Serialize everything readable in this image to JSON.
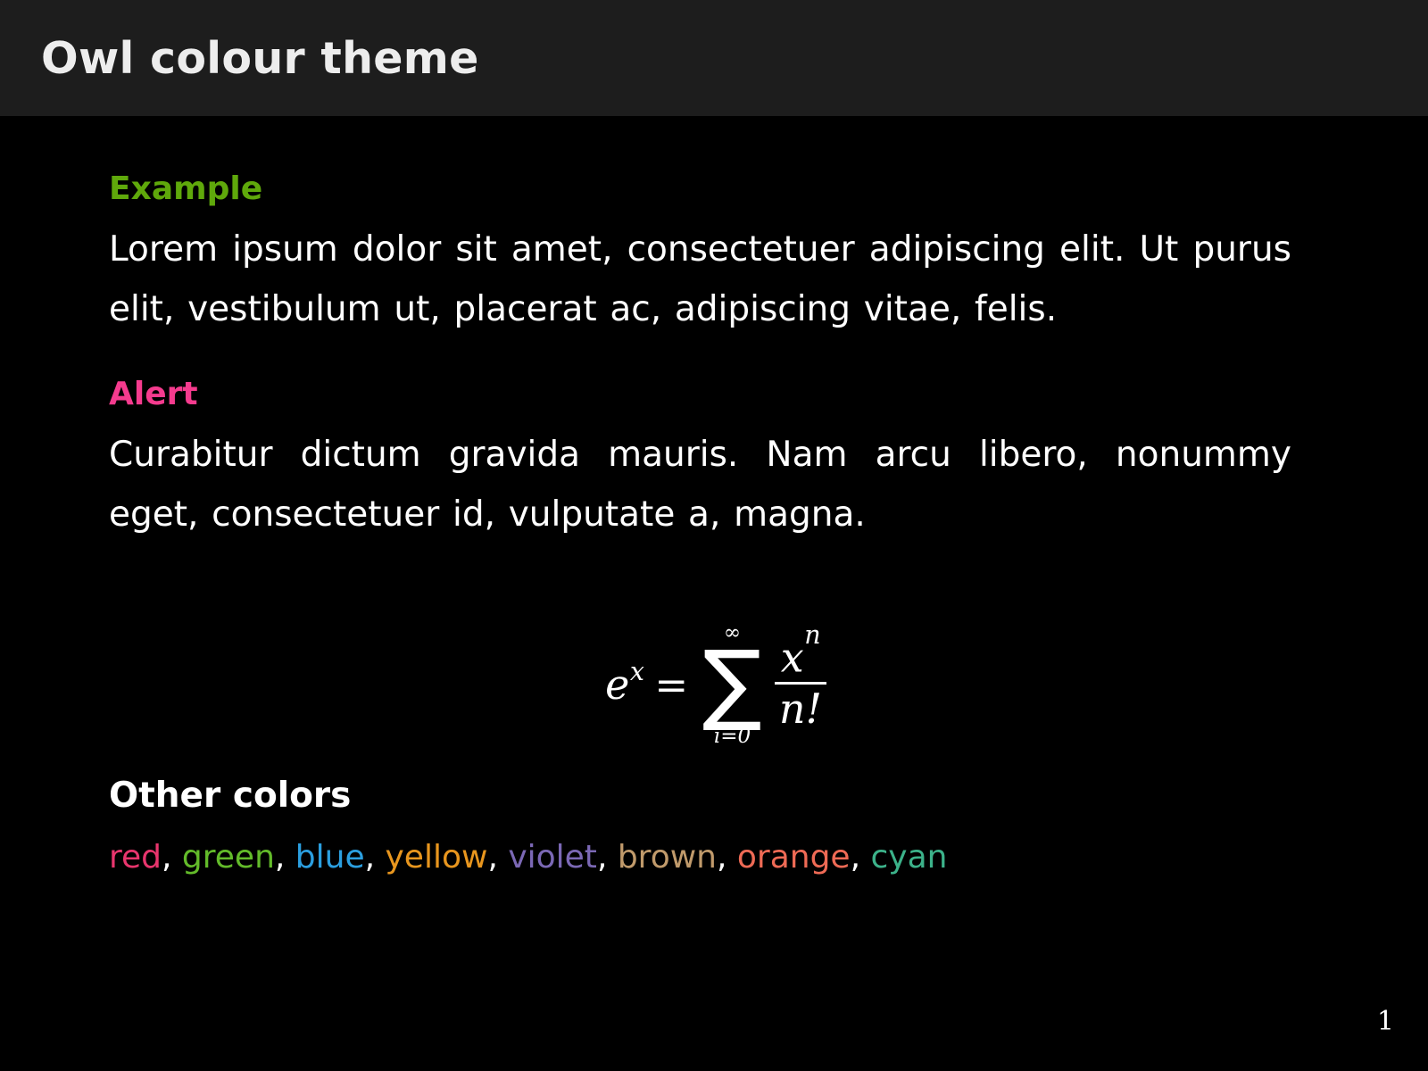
{
  "slide": {
    "title": "Owl colour theme",
    "page_number": "1",
    "background_color": "#000000",
    "titlebar_color": "#1d1d1d",
    "text_color": "#ffffff"
  },
  "blocks": [
    {
      "kind": "example",
      "heading": "Example",
      "heading_color": "#5fa80b",
      "body": "Lorem ipsum dolor sit amet, consectetuer adipiscing elit. Ut purus elit, vestibulum ut, placerat ac, adipiscing vitae, felis."
    },
    {
      "kind": "alert",
      "heading": "Alert",
      "heading_color": "#f53b8e",
      "body": "Curabitur dictum gravida mauris. Nam arcu libero, nonummy eget, consectetuer id, vulputate a, magna."
    }
  ],
  "formula": {
    "base": "e",
    "base_exponent": "x",
    "equals": "=",
    "sigma": "∑",
    "sigma_upper": "∞",
    "sigma_lower": "i=0",
    "numerator_base": "x",
    "numerator_exponent": "n",
    "denominator": "n!",
    "plain": "e^x = sum_{i=0}^{infinity} x^n / n!"
  },
  "other_colors": {
    "heading": "Other colors",
    "separator": ", ",
    "items": [
      {
        "label": "red",
        "color": "#e8356d"
      },
      {
        "label": "green",
        "color": "#63bb2a"
      },
      {
        "label": "blue",
        "color": "#2b9fe0"
      },
      {
        "label": "yellow",
        "color": "#e8961e"
      },
      {
        "label": "violet",
        "color": "#7b68b5"
      },
      {
        "label": "brown",
        "color": "#c09a6b"
      },
      {
        "label": "orange",
        "color": "#ee6a55"
      },
      {
        "label": "cyan",
        "color": "#3cb28a"
      }
    ]
  }
}
